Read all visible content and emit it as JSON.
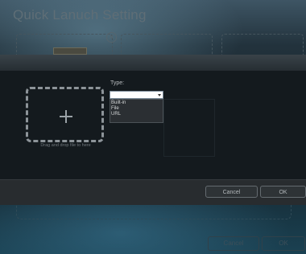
{
  "window": {
    "title": "Quick Lanuch Setting"
  },
  "dialog": {
    "drop_hint": "Drag and drop file to here",
    "type_label": "Type:",
    "type_select": {
      "value": "",
      "options": [
        "Built-in",
        "File",
        "URL"
      ]
    },
    "cancel_label": "Cancel",
    "ok_label": "OK"
  },
  "background_buttons": {
    "cancel_label": "Cancel",
    "ok_label": "OK"
  },
  "colors": {
    "dialog_bg": "#141a1e",
    "footer_bg": "#282c2f",
    "accent_text": "#b8bcbf"
  }
}
